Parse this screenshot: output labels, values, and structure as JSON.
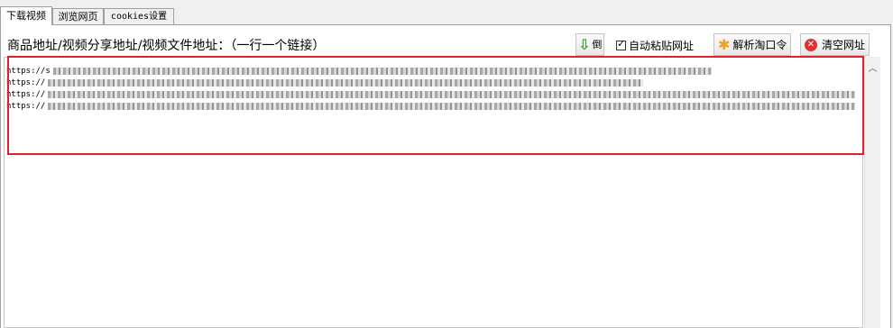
{
  "tabs": [
    {
      "label": "下载视频",
      "active": true
    },
    {
      "label": "浏览网页",
      "active": false
    },
    {
      "label": "cookies设置",
      "active": false
    }
  ],
  "main": {
    "field_label": "商品地址/视频分享地址/视频文件地址：（一行一个链接）"
  },
  "toolbar": {
    "invert_label": "倒序",
    "auto_paste_label": "自动粘贴网址",
    "auto_paste_checked": true,
    "parse_label": "解析淘口令",
    "clear_label": "清空网址"
  },
  "urls": [
    {
      "text": "https://s"
    },
    {
      "text": "https://"
    },
    {
      "text": "https://"
    },
    {
      "text": "https://"
    }
  ],
  "colors": {
    "highlight_border": "#e0202c",
    "invert_icon": "#3aa02a",
    "parse_icon": "#f0a020",
    "clear_icon": "#e03030"
  }
}
